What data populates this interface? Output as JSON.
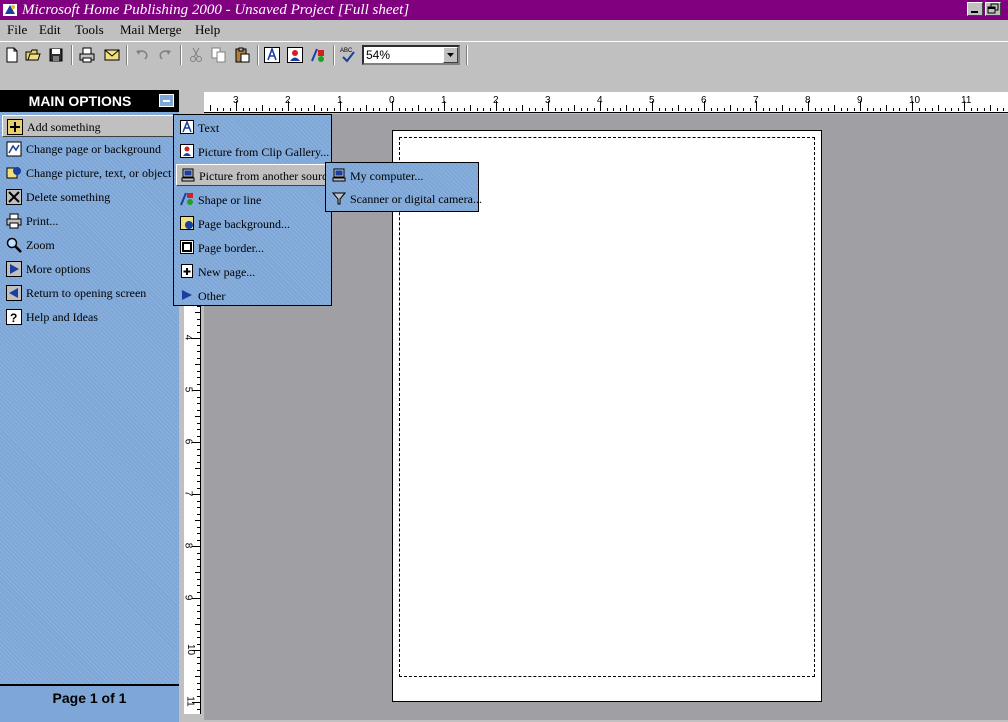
{
  "window": {
    "title": "Microsoft Home Publishing 2000 - Unsaved Project [Full sheet]",
    "caption_buttons": [
      "minimize",
      "restore"
    ]
  },
  "menu": [
    "File",
    "Edit",
    "Tools",
    "Mail Merge",
    "Help"
  ],
  "toolbar": {
    "icons": [
      "new-icon",
      "open-icon",
      "save-icon",
      "print-icon",
      "mail-icon",
      "undo-icon",
      "redo-icon",
      "cut-icon",
      "copy-icon",
      "paste-icon",
      "text-tool-icon",
      "picture-tool-icon",
      "shape-tool-icon",
      "spell-check-icon"
    ],
    "zoom_value": "54%"
  },
  "side_panel": {
    "title": "MAIN OPTIONS",
    "options": [
      {
        "label": "Add something",
        "icon": "plus-icon",
        "selected": true
      },
      {
        "label": "Change page or background",
        "icon": "page-icon"
      },
      {
        "label": "Change picture, text, or object",
        "icon": "change-object-icon"
      },
      {
        "label": "Delete something",
        "icon": "delete-icon"
      },
      {
        "label": "Print...",
        "icon": "printer-icon"
      },
      {
        "label": "Zoom",
        "icon": "magnifier-icon"
      },
      {
        "label": "More options",
        "icon": "right-arrow-icon"
      },
      {
        "label": "Return to opening screen",
        "icon": "left-arrow-icon"
      },
      {
        "label": "Help and Ideas",
        "icon": "help-icon"
      }
    ],
    "page_indicator": "Page 1 of 1"
  },
  "add_menu": [
    {
      "label": "Text",
      "icon": "text-box-icon"
    },
    {
      "label": "Picture from Clip Gallery...",
      "icon": "clip-gallery-icon"
    },
    {
      "label": "Picture from another source",
      "icon": "computer-icon",
      "selected": true
    },
    {
      "label": "Shape or line",
      "icon": "shapes-icon"
    },
    {
      "label": "Page background...",
      "icon": "background-icon"
    },
    {
      "label": "Page border...",
      "icon": "border-icon"
    },
    {
      "label": "New page...",
      "icon": "new-page-icon"
    },
    {
      "label": "Other",
      "icon": "right-arrow-icon"
    }
  ],
  "source_menu": [
    {
      "label": "My computer...",
      "icon": "computer-icon"
    },
    {
      "label": "Scanner or digital camera...",
      "icon": "scanner-icon"
    }
  ],
  "ruler": {
    "horizontal": [
      "3",
      "2",
      "1",
      "0",
      "1",
      "2",
      "3",
      "4",
      "5",
      "6",
      "7",
      "8",
      "9",
      "10",
      "11"
    ],
    "vertical": [
      "4",
      "5",
      "6",
      "7",
      "8",
      "9",
      "10",
      "11"
    ]
  },
  "colors": {
    "title_bar": "#800080",
    "panel": "#7ea7d8",
    "workspace": "#a0a0a4"
  }
}
